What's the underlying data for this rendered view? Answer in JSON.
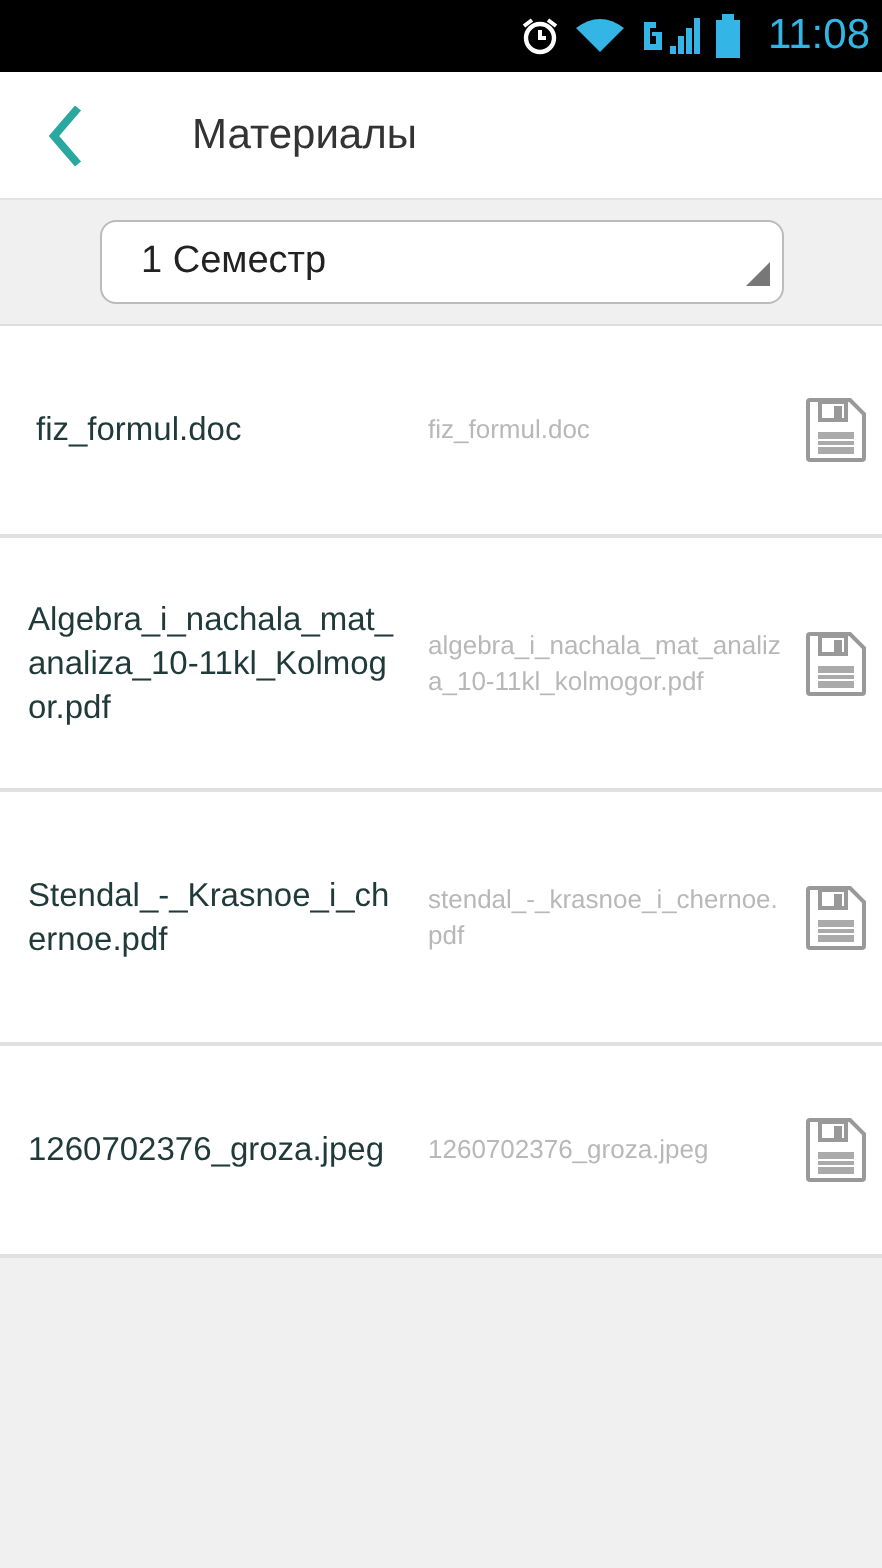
{
  "status_bar": {
    "time": "11:08"
  },
  "header": {
    "title": "Материалы"
  },
  "semester_select": {
    "value": "1 Семестр"
  },
  "files": [
    {
      "title": "fiz_formul.doc",
      "filename": "fiz_formul.doc"
    },
    {
      "title": "Algebra_i_nachala_mat_analiza_10-11kl_Kolmogor.pdf",
      "filename": "algebra_i_nachala_mat_analiza_10-11kl_kolmogor.pdf"
    },
    {
      "title": "Stendal_-_Krasnoe_i_chernoe.pdf",
      "filename": "stendal_-_krasnoe_i_chernoe.pdf"
    },
    {
      "title": "1260702376_groza.jpeg",
      "filename": "1260702376_groza.jpeg"
    }
  ]
}
